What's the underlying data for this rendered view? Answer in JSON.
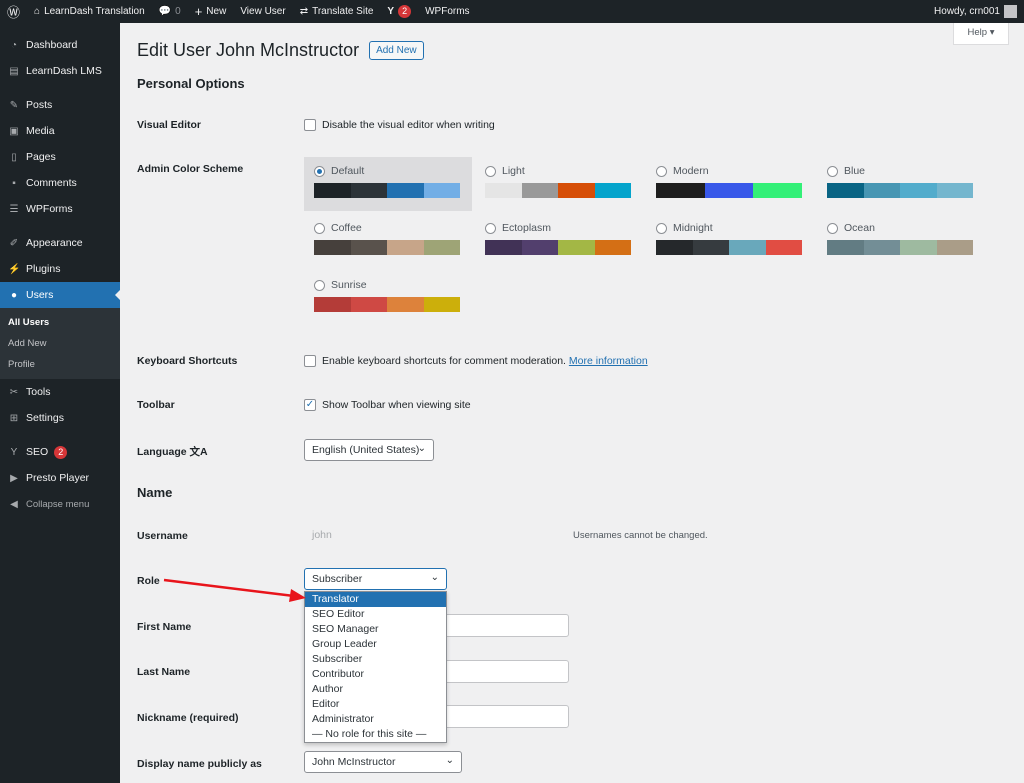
{
  "adminbar": {
    "site": "LearnDash Translation",
    "comments": "0",
    "new": "New",
    "view_user": "View User",
    "translate": "Translate Site",
    "yoast_count": "2",
    "wpforms": "WPForms",
    "howdy": "Howdy, crn001"
  },
  "sidebar": {
    "items": [
      {
        "label": "Dashboard",
        "icon": "dashboard-icon"
      },
      {
        "label": "LearnDash LMS",
        "icon": "learndash-icon"
      },
      {
        "label": "Posts",
        "icon": "pin-icon"
      },
      {
        "label": "Media",
        "icon": "media-icon"
      },
      {
        "label": "Pages",
        "icon": "pages-icon"
      },
      {
        "label": "Comments",
        "icon": "comment-icon"
      },
      {
        "label": "WPForms",
        "icon": "wpforms-icon"
      },
      {
        "label": "Appearance",
        "icon": "brush-icon"
      },
      {
        "label": "Plugins",
        "icon": "plugin-icon"
      },
      {
        "label": "Users",
        "icon": "user-icon"
      },
      {
        "label": "Tools",
        "icon": "wrench-icon"
      },
      {
        "label": "Settings",
        "icon": "settings-icon"
      },
      {
        "label": "SEO",
        "icon": "yoast-icon",
        "badge": "2"
      },
      {
        "label": "Presto Player",
        "icon": "play-icon"
      },
      {
        "label": "Collapse menu",
        "icon": "collapse-icon"
      }
    ],
    "sub": [
      "All Users",
      "Add New",
      "Profile"
    ]
  },
  "page": {
    "title": "Edit User John McInstructor",
    "add_new": "Add New",
    "help": "Help"
  },
  "personal": {
    "heading": "Personal Options",
    "visual_editor": "Visual Editor",
    "visual_editor_cb": "Disable the visual editor when writing",
    "color_scheme": "Admin Color Scheme",
    "schemes": [
      {
        "name": "Default",
        "colors": [
          "#1d2327",
          "#2c3338",
          "#2271b1",
          "#72aee6"
        ],
        "selected": true
      },
      {
        "name": "Light",
        "colors": [
          "#e5e5e5",
          "#999999",
          "#d64e07",
          "#04a4cc"
        ]
      },
      {
        "name": "Modern",
        "colors": [
          "#1e1e1e",
          "#3858e9",
          "#33f078"
        ]
      },
      {
        "name": "Blue",
        "colors": [
          "#096484",
          "#4796b3",
          "#52accc",
          "#74b6ce"
        ]
      },
      {
        "name": "Coffee",
        "colors": [
          "#46403c",
          "#59524c",
          "#c7a589",
          "#9ea476"
        ]
      },
      {
        "name": "Ectoplasm",
        "colors": [
          "#413256",
          "#523f6d",
          "#a3b745",
          "#d46f15"
        ]
      },
      {
        "name": "Midnight",
        "colors": [
          "#25282b",
          "#363b3f",
          "#69a8bb",
          "#e14d43"
        ]
      },
      {
        "name": "Ocean",
        "colors": [
          "#627c83",
          "#738e96",
          "#9ebaa0",
          "#aa9d88"
        ]
      },
      {
        "name": "Sunrise",
        "colors": [
          "#b43c38",
          "#cf4944",
          "#dd823b",
          "#ccaf0b"
        ]
      }
    ],
    "keyboard": "Keyboard Shortcuts",
    "keyboard_cb": "Enable keyboard shortcuts for comment moderation.",
    "more_info": "More information",
    "toolbar": "Toolbar",
    "toolbar_cb": "Show Toolbar when viewing site",
    "language": "Language",
    "language_value": "English (United States)"
  },
  "name": {
    "heading": "Name",
    "username": "Username",
    "username_value": "john",
    "username_note": "Usernames cannot be changed.",
    "role": "Role",
    "role_value": "Subscriber",
    "role_options": [
      "Translator",
      "SEO Editor",
      "SEO Manager",
      "Group Leader",
      "Subscriber",
      "Contributor",
      "Author",
      "Editor",
      "Administrator",
      "— No role for this site —"
    ],
    "first": "First Name",
    "last": "Last Name",
    "nickname": "Nickname (required)",
    "display": "Display name publicly as",
    "display_value": "John McInstructor"
  }
}
